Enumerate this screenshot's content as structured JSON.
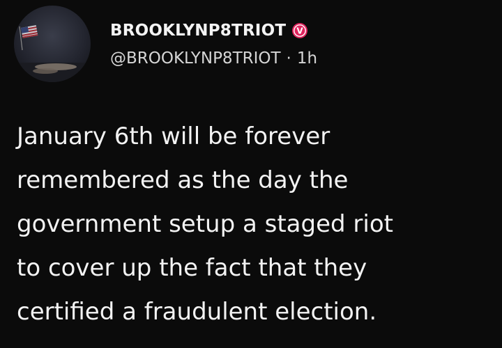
{
  "post": {
    "display_name": "BROOKLYNP8TRIOT",
    "badge_icon": "verified-v-icon",
    "badge_letter": "V",
    "badge_color": "#e0245e",
    "handle": "@BROOKLYNP8TRIOT",
    "separator": "·",
    "timestamp": "1h",
    "body_lines": [
      "January 6th will be forever",
      "remembered as the day the",
      "government setup a staged riot",
      "to cover up the fact that they",
      "certified a fraudulent election."
    ]
  },
  "colors": {
    "background": "#0b0b0b",
    "text": "#f3f3f3",
    "secondary_text": "#d6d6d6"
  }
}
